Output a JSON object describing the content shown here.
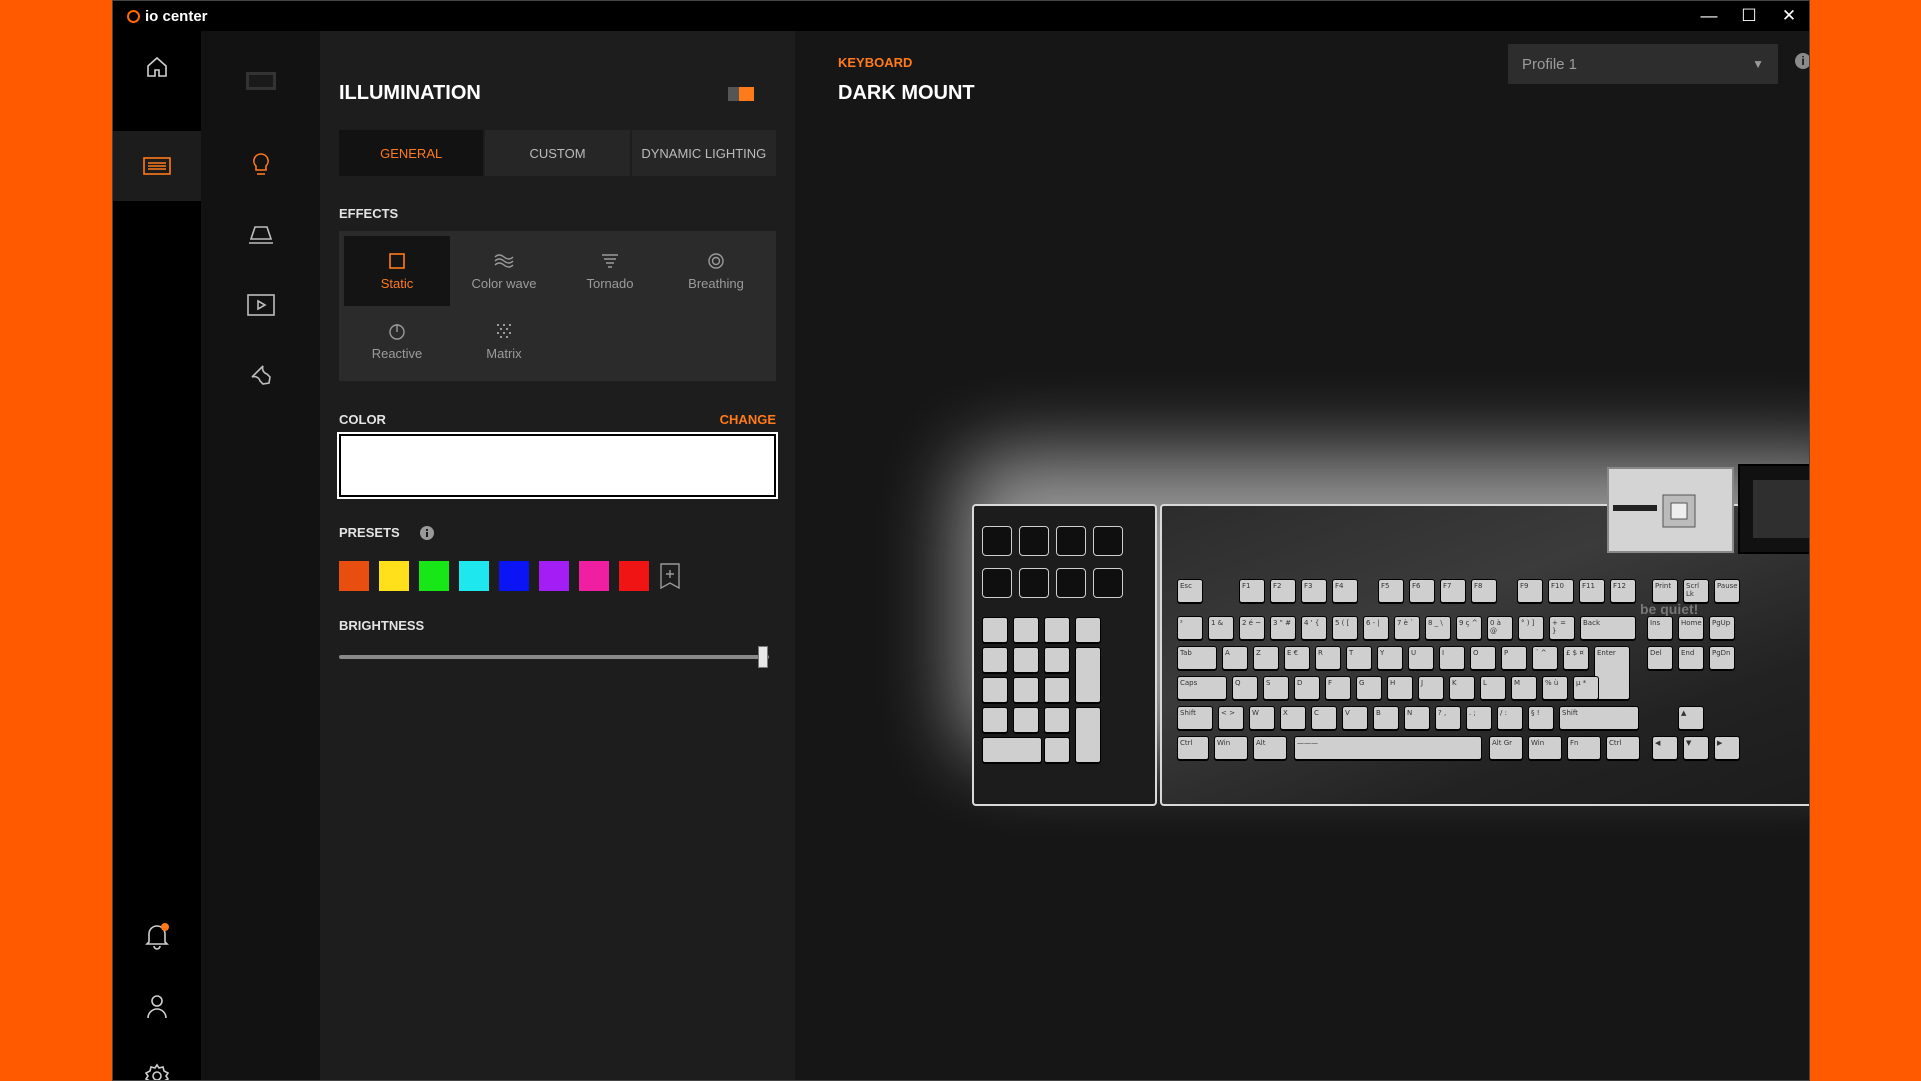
{
  "app": {
    "name": "io center"
  },
  "window_controls": {
    "minimize": "—",
    "maximize": "☐",
    "close": "✕"
  },
  "rail": [
    {
      "icon": "home-icon"
    },
    {
      "icon": "keyboard-icon",
      "active": true
    },
    {
      "icon": "bell-icon"
    },
    {
      "icon": "user-icon"
    },
    {
      "icon": "gear-icon"
    }
  ],
  "panel": {
    "title": "ILLUMINATION",
    "toggle": {
      "on": true,
      "accent": "#ff7a1a"
    },
    "tabs": [
      {
        "label": "GENERAL",
        "active": true
      },
      {
        "label": "CUSTOM"
      },
      {
        "label": "DYNAMIC LIGHTING"
      }
    ],
    "effects_label": "EFFECTS",
    "effects": [
      {
        "label": "Static",
        "icon": "square-icon",
        "active": true
      },
      {
        "label": "Color wave",
        "icon": "wave-icon"
      },
      {
        "label": "Tornado",
        "icon": "tornado-icon"
      },
      {
        "label": "Breathing",
        "icon": "breathing-icon"
      },
      {
        "label": "Reactive",
        "icon": "reactive-icon"
      },
      {
        "label": "Matrix",
        "icon": "matrix-icon"
      }
    ],
    "color_label": "COLOR",
    "change_label": "CHANGE",
    "current_color": "#ffffff",
    "presets_label": "PRESETS",
    "presets": [
      "#e84e0f",
      "#ffe01a",
      "#17e617",
      "#1ee8ee",
      "#0a14f5",
      "#a21ef5",
      "#f01ea0",
      "#f01414"
    ],
    "brightness_label": "BRIGHTNESS",
    "brightness": 1.0
  },
  "main": {
    "category": "KEYBOARD",
    "device": "DARK MOUNT",
    "profile": "Profile 1",
    "info": "i",
    "brand_mark": "be quiet!"
  },
  "keys": {
    "row0": [
      "Esc",
      "F1",
      "F2",
      "F3",
      "F4",
      "F5",
      "F6",
      "F7",
      "F8",
      "F9",
      "F10",
      "F11",
      "F12",
      "Print",
      "Scrl Lk",
      "Pause"
    ],
    "row1": [
      "²",
      "1 &",
      "2 é ~",
      "3 \" #",
      "4 ' {",
      "5 ( [",
      "6 - |",
      "7 è `",
      "8 _ \\",
      "9 ç ^",
      "0 à @",
      "° ) ]",
      "+ = }",
      "Back",
      "Ins",
      "Home",
      "PgUp"
    ],
    "row2": [
      "Tab",
      "A",
      "Z",
      "E €",
      "R",
      "T",
      "Y",
      "U",
      "I",
      "O",
      "P",
      "¨ ^",
      "£ $ ¤",
      "Enter",
      "Del",
      "End",
      "PgDn"
    ],
    "row3": [
      "Caps",
      "Q",
      "S",
      "D",
      "F",
      "G",
      "H",
      "J",
      "K",
      "L",
      "M",
      "% ù",
      "µ *"
    ],
    "row4": [
      "Shift",
      "< >",
      "W",
      "X",
      "C",
      "V",
      "B",
      "N",
      "? ,",
      ". ;",
      "/ :",
      "§ !",
      "Shift",
      "▲"
    ],
    "row5": [
      "Ctrl",
      "Win",
      "Alt",
      "———",
      "Alt Gr",
      "Win",
      "Fn",
      "Ctrl",
      "◀",
      "▼",
      "▶"
    ]
  }
}
